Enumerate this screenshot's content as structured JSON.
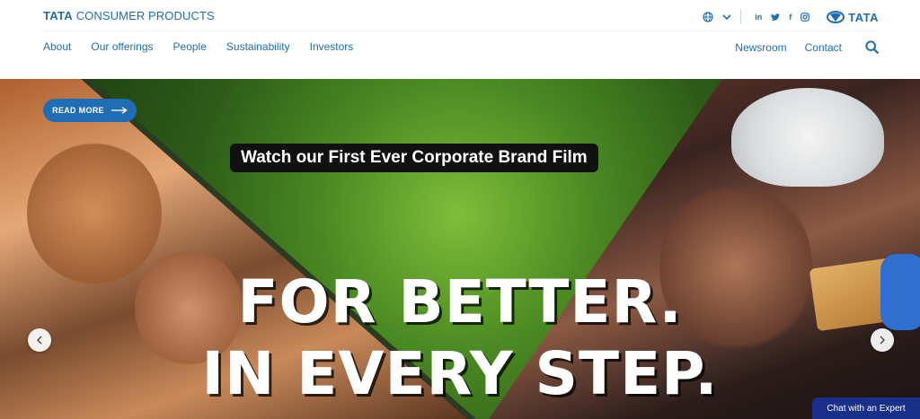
{
  "header": {
    "brand_prefix": "TATA",
    "brand_suffix": "CONSUMER PRODUCTS",
    "logo_text": "TATA",
    "social": [
      "in",
      "t",
      "f",
      "ig"
    ],
    "nav": {
      "about": "About",
      "offerings": "Our offerings",
      "people": "People",
      "sustainability": "Sustainability",
      "investors": "Investors",
      "newsroom": "Newsroom",
      "contact": "Contact"
    }
  },
  "hero": {
    "read_more": "READ MORE",
    "film_banner": "Watch our First Ever Corporate Brand Film",
    "headline_line1": "FOR BETTER.",
    "headline_line2": "IN EVERY STEP."
  },
  "chat": {
    "label": "Chat with an Expert"
  },
  "colors": {
    "brand_blue": "#1f6db3",
    "chat_bg": "#1a2f8a"
  }
}
